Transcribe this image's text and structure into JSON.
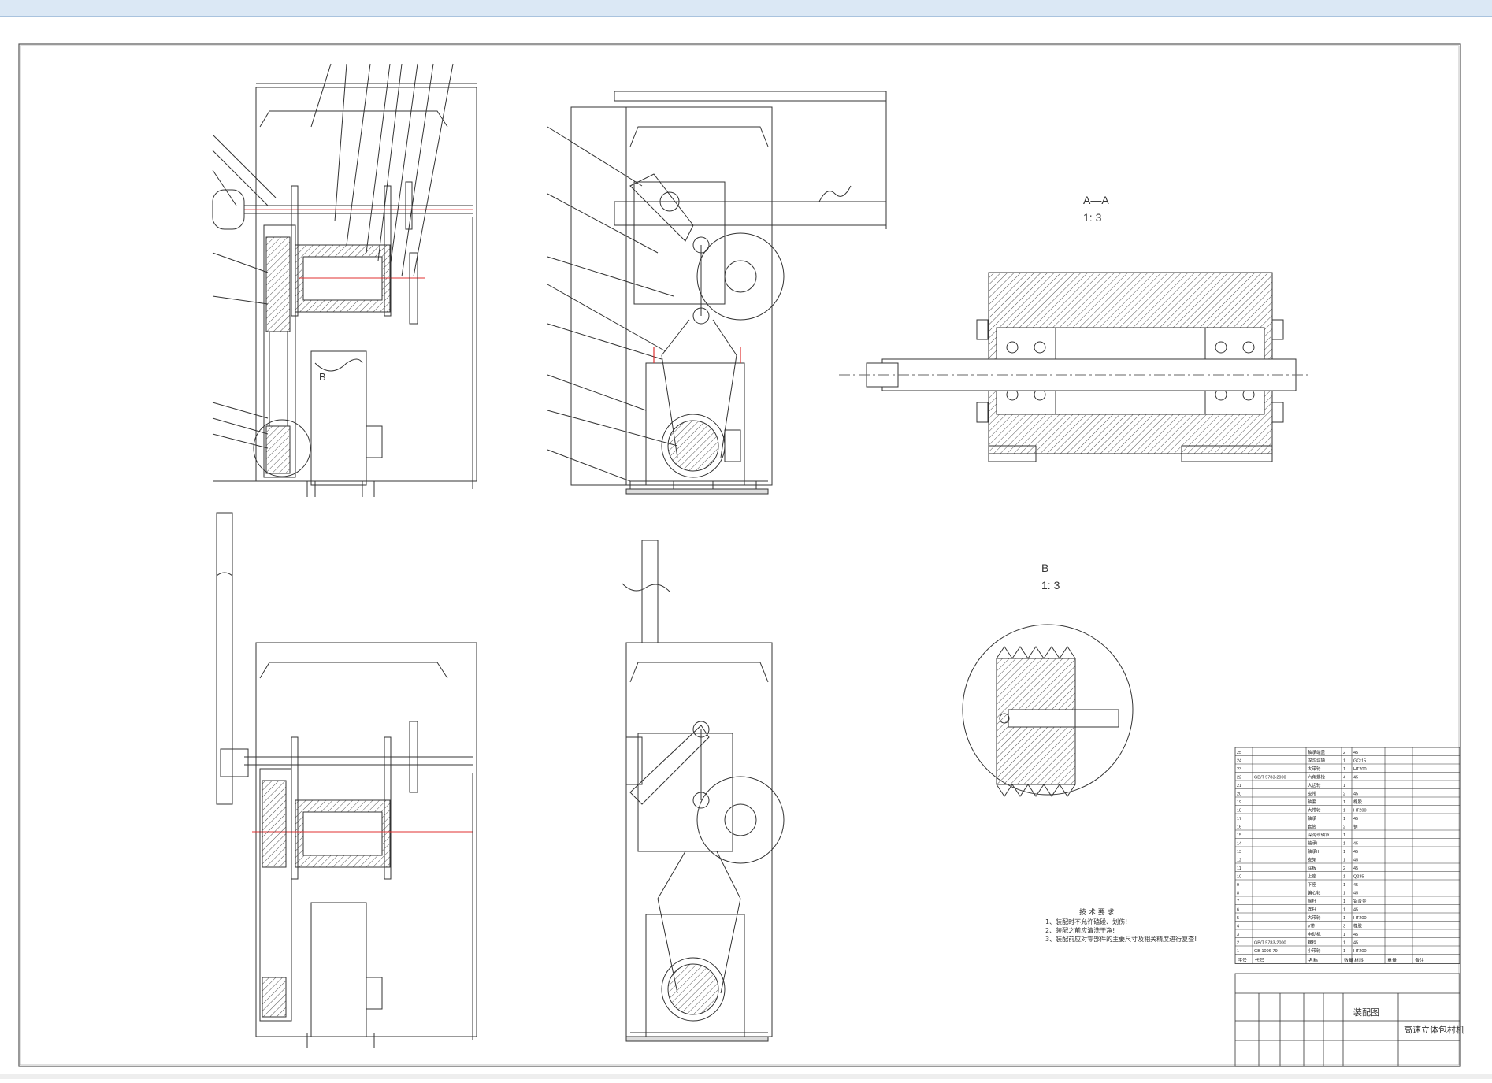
{
  "views": {
    "section_aa": {
      "label": "A—A",
      "scale": "1: 3"
    },
    "detail_b": {
      "label": "B",
      "scale": "1: 3"
    },
    "detail_b_callout": "B"
  },
  "technical_requirements": {
    "heading": "技 术 要 求",
    "items": [
      "1、装配时不允许磕碰、划伤!",
      "2、装配之前应清洗干净!",
      "3、装配前应对零部件的主要尺寸及相关精度进行复查!"
    ]
  },
  "title_block": {
    "drawing_name": "装配图",
    "machine_name": "高速立体包村机",
    "columns": [
      "序号",
      "代号",
      "名称",
      "数量",
      "材料",
      "重量",
      "备注"
    ]
  },
  "bom": [
    {
      "no": "25",
      "code": "",
      "name": "轴承端盖",
      "qty": "2",
      "material": "45"
    },
    {
      "no": "24",
      "code": "",
      "name": "深沟球轴",
      "qty": "1",
      "material": "GCr15"
    },
    {
      "no": "23",
      "code": "",
      "name": "大带轮",
      "qty": "1",
      "material": "HT200"
    },
    {
      "no": "22",
      "code": "GB/T 5783-2000",
      "name": "六角螺栓",
      "qty": "4",
      "material": "45"
    },
    {
      "no": "21",
      "code": "",
      "name": "大齿轮",
      "qty": "1",
      "material": ""
    },
    {
      "no": "20",
      "code": "",
      "name": "皮带",
      "qty": "2",
      "material": "45"
    },
    {
      "no": "19",
      "code": "",
      "name": "轴套",
      "qty": "1",
      "material": "橡胶"
    },
    {
      "no": "18",
      "code": "",
      "name": "大带轮",
      "qty": "1",
      "material": "HT200"
    },
    {
      "no": "17",
      "code": "",
      "name": "轴承",
      "qty": "1",
      "material": "45"
    },
    {
      "no": "16",
      "code": "",
      "name": "套筒",
      "qty": "2",
      "material": "钢"
    },
    {
      "no": "15",
      "code": "",
      "name": "深沟球轴承",
      "qty": "1",
      "material": ""
    },
    {
      "no": "14",
      "code": "",
      "name": "轴承I",
      "qty": "1",
      "material": "45"
    },
    {
      "no": "13",
      "code": "",
      "name": "轴承II",
      "qty": "1",
      "material": "45"
    },
    {
      "no": "12",
      "code": "",
      "name": "支架",
      "qty": "1",
      "material": "45"
    },
    {
      "no": "11",
      "code": "",
      "name": "底板",
      "qty": "2",
      "material": "45"
    },
    {
      "no": "10",
      "code": "",
      "name": "上座",
      "qty": "1",
      "material": "Q235"
    },
    {
      "no": "9",
      "code": "",
      "name": "下座",
      "qty": "1",
      "material": "45"
    },
    {
      "no": "8",
      "code": "",
      "name": "偏心轮",
      "qty": "1",
      "material": "45"
    },
    {
      "no": "7",
      "code": "",
      "name": "摇杆",
      "qty": "1",
      "material": "铝合金"
    },
    {
      "no": "6",
      "code": "",
      "name": "连杆",
      "qty": "1",
      "material": "45"
    },
    {
      "no": "5",
      "code": "",
      "name": "大带轮",
      "qty": "1",
      "material": "HT200"
    },
    {
      "no": "4",
      "code": "",
      "name": "V带",
      "qty": "3",
      "material": "橡胶"
    },
    {
      "no": "3",
      "code": "",
      "name": "电动机",
      "qty": "1",
      "material": "45"
    },
    {
      "no": "2",
      "code": "GB/T 5783-2000",
      "name": "螺栓",
      "qty": "1",
      "material": "45"
    },
    {
      "no": "1",
      "code": "GB 1096-79",
      "name": "小带轮",
      "qty": "1",
      "material": "HT200"
    }
  ],
  "colors": {
    "line": "#333333",
    "centerline": "#e03030",
    "hatch": "#555555",
    "topbar": "#dbe8f5"
  }
}
